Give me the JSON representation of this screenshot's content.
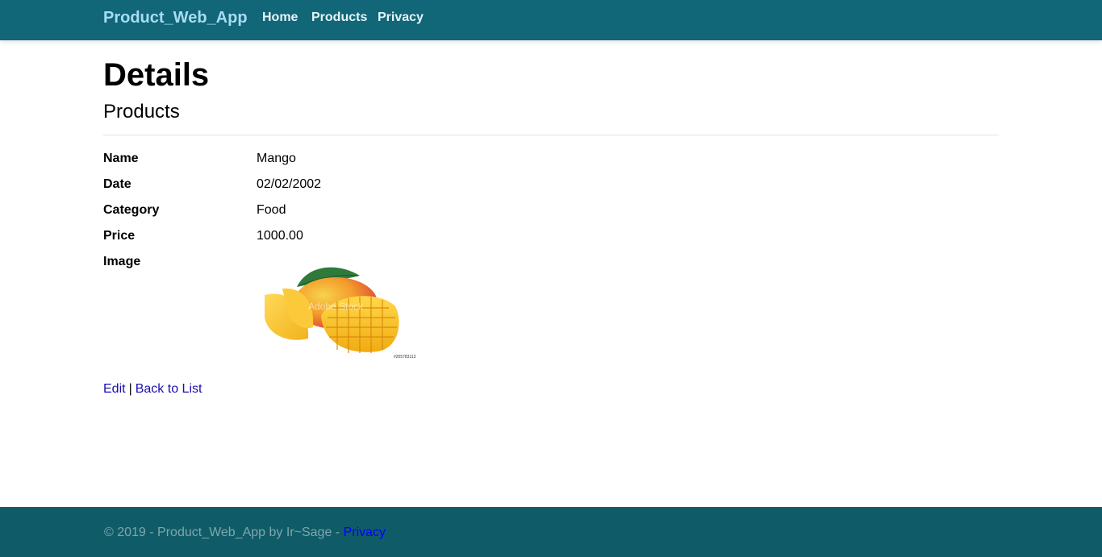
{
  "nav": {
    "brand": "Product_Web_App",
    "links": [
      "Home",
      "Products",
      "Privacy"
    ]
  },
  "page": {
    "title": "Details",
    "subtitle": "Products"
  },
  "details": {
    "name_label": "Name",
    "name_value": "Mango",
    "date_label": "Date",
    "date_value": "02/02/2002",
    "category_label": "Category",
    "category_value": "Food",
    "price_label": "Price",
    "price_value": "1000.00",
    "image_label": "Image",
    "image_alt": "Mango image",
    "image_watermark": "Adobe Stock",
    "image_stock_id": "#205783113"
  },
  "actions": {
    "edit": "Edit",
    "separator": "|",
    "back": "Back to List"
  },
  "footer": {
    "text": "© 2019 - Product_Web_App by Ir~Sage - ",
    "privacy": "Privacy"
  },
  "colors": {
    "navbar": "#116677",
    "footer": "#0f5c68",
    "link": "#1a0dab",
    "brand": "#a6ddf3"
  }
}
